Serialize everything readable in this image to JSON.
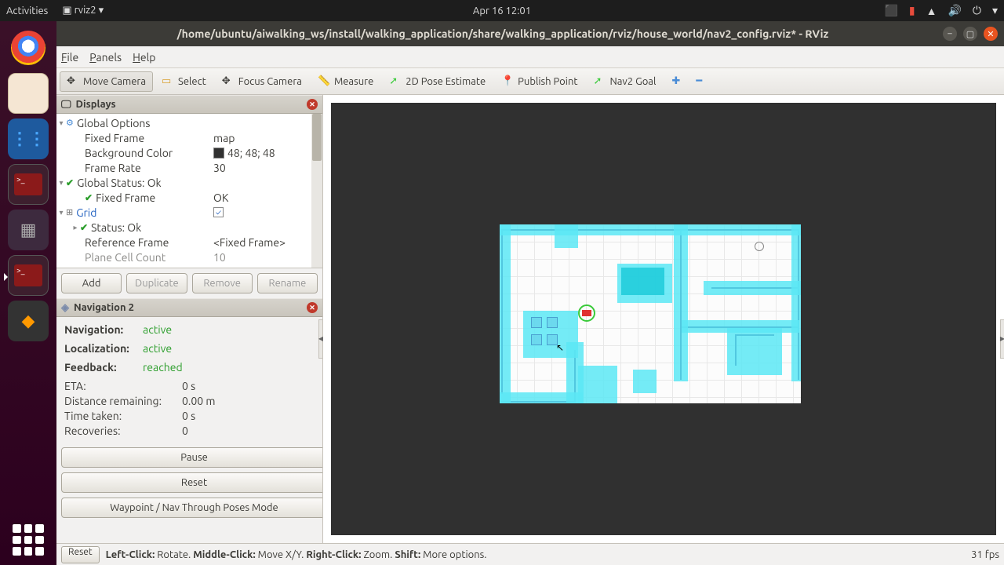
{
  "topbar": {
    "activities": "Activities",
    "app": "rviz2",
    "clock": "Apr 16  12:01"
  },
  "window": {
    "title": "/home/ubuntu/aiwalking_ws/install/walking_application/share/walking_application/rviz/house_world/nav2_config.rviz* - RViz"
  },
  "menubar": {
    "file": "File",
    "panels": "Panels",
    "help": "Help"
  },
  "toolbar": {
    "move_camera": "Move Camera",
    "select": "Select",
    "focus_camera": "Focus Camera",
    "measure": "Measure",
    "pose_estimate": "2D Pose Estimate",
    "publish_point": "Publish Point",
    "nav_goal": "Nav2 Goal"
  },
  "displays": {
    "title": "Displays",
    "global_options": "Global Options",
    "fixed_frame": "Fixed Frame",
    "fixed_frame_val": "map",
    "bg_color": "Background Color",
    "bg_color_val": "48; 48; 48",
    "frame_rate": "Frame Rate",
    "frame_rate_val": "30",
    "global_status": "Global Status: Ok",
    "fixed_frame2": "Fixed Frame",
    "fixed_frame2_val": "OK",
    "grid": "Grid",
    "status_ok": "Status: Ok",
    "ref_frame": "Reference Frame",
    "ref_frame_val": "<Fixed Frame>",
    "plane_cell": "Plane Cell Count",
    "plane_cell_val": "10",
    "add": "Add",
    "duplicate": "Duplicate",
    "remove": "Remove",
    "rename": "Rename"
  },
  "nav2": {
    "title": "Navigation 2",
    "navigation_lbl": "Navigation:",
    "navigation_val": "active",
    "localization_lbl": "Localization:",
    "localization_val": "active",
    "feedback_lbl": "Feedback:",
    "feedback_val": "reached",
    "eta_lbl": "ETA:",
    "eta_val": "0 s",
    "dist_lbl": "Distance remaining:",
    "dist_val": "0.00 m",
    "time_lbl": "Time taken:",
    "time_val": "0 s",
    "recov_lbl": "Recoveries:",
    "recov_val": "0",
    "pause": "Pause",
    "reset": "Reset",
    "waypoint": "Waypoint / Nav Through Poses Mode"
  },
  "statusbar": {
    "reset": "Reset",
    "lc": "Left-Click:",
    "lc_v": " Rotate. ",
    "mc": "Middle-Click:",
    "mc_v": " Move X/Y. ",
    "rc": "Right-Click:",
    "rc_v": " Zoom. ",
    "sh": "Shift:",
    "sh_v": " More options.",
    "fps": "31 fps"
  }
}
